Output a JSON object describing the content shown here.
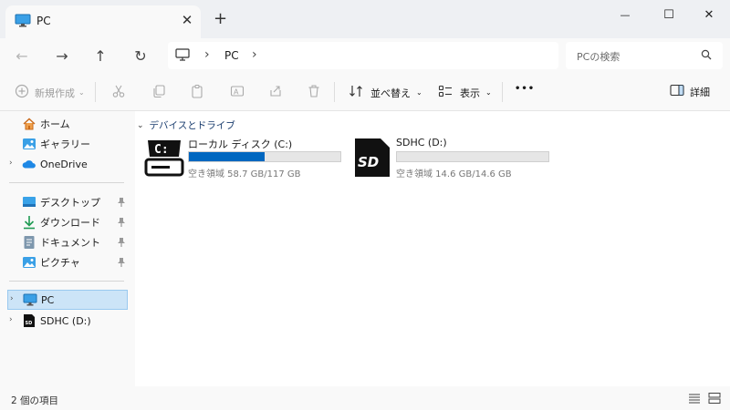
{
  "tab": {
    "title": "PC",
    "close": "✕",
    "new": "+"
  },
  "window": {
    "minimize": "—",
    "maximize": "☐",
    "close": "✕"
  },
  "nav": {
    "back": "←",
    "forward": "→",
    "up": "↑",
    "refresh": "↻"
  },
  "address": {
    "separator": "›",
    "segment": "PC"
  },
  "search": {
    "placeholder": "PCの検索"
  },
  "toolbar": {
    "new_label": "新規作成",
    "sort_label": "並べ替え",
    "view_label": "表示",
    "more": "•••",
    "details_label": "詳細"
  },
  "sidebar": {
    "quick": [
      {
        "label": "ホーム"
      },
      {
        "label": "ギャラリー"
      },
      {
        "label": "OneDrive"
      }
    ],
    "pinned": [
      {
        "label": "デスクトップ"
      },
      {
        "label": "ダウンロード"
      },
      {
        "label": "ドキュメント"
      },
      {
        "label": "ピクチャ"
      }
    ],
    "devices": [
      {
        "label": "PC"
      },
      {
        "label": "SDHC (D:)"
      }
    ]
  },
  "content": {
    "group_header": "デバイスとドライブ",
    "drives": [
      {
        "name": "ローカル ディスク (C:)",
        "free": "空き領域 58.7 GB/117 GB",
        "used_fraction": 0.5,
        "icon_letter": "C:"
      },
      {
        "name": "SDHC (D:)",
        "free": "空き領域 14.6 GB/14.6 GB",
        "used_fraction": 0.0,
        "icon_letter": "SD"
      }
    ]
  },
  "status": {
    "text": "2 個の項目"
  },
  "colors": {
    "accent": "#0067c0",
    "selection": "#cce4f7",
    "folder_blue": "#1e88e5"
  }
}
